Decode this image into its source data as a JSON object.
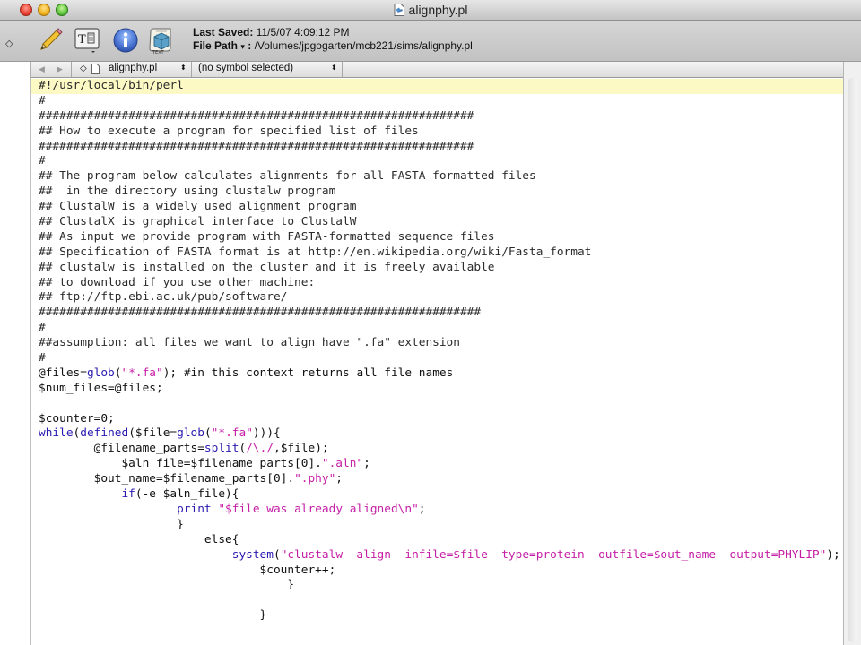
{
  "window": {
    "title": "alignphy.pl"
  },
  "toolbar": {
    "last_saved_label": "Last Saved:",
    "last_saved_value": "11/5/07 4:09:12 PM",
    "file_path_label": "File Path",
    "file_path_arrow": "▾",
    "file_path_sep": ":",
    "file_path_value": "/Volumes/jpgogarten/mcb221/sims/alignphy.pl",
    "icons": [
      "pencil-icon",
      "text-options-icon",
      "info-icon",
      "script-icon"
    ]
  },
  "navbar": {
    "back": "◀",
    "forward": "▶",
    "file_name": "alignphy.pl",
    "file_updown": "⬍",
    "symbol": "(no symbol selected)",
    "symbol_updown": "⬍"
  },
  "colors": {
    "comment": "#2b2b2b",
    "keyword": "#2a1ab0",
    "string": "#c51ea6",
    "highlight_line": "#fdf9c4"
  },
  "code": {
    "lines": [
      [
        {
          "t": "#!/usr/local/bin/perl",
          "c": "cm"
        }
      ],
      [
        {
          "t": "#",
          "c": "cm"
        }
      ],
      [
        {
          "t": "###############################################################",
          "c": "cm"
        }
      ],
      [
        {
          "t": "## How to execute a program for specified list of files",
          "c": "cm"
        }
      ],
      [
        {
          "t": "###############################################################",
          "c": "cm"
        }
      ],
      [
        {
          "t": "#",
          "c": "cm"
        }
      ],
      [
        {
          "t": "## The program below calculates alignments for all FASTA-formatted files",
          "c": "cm"
        }
      ],
      [
        {
          "t": "##  in the directory using clustalw program",
          "c": "cm"
        }
      ],
      [
        {
          "t": "## ClustalW is a widely used alignment program",
          "c": "cm"
        }
      ],
      [
        {
          "t": "## ClustalX is graphical interface to ClustalW",
          "c": "cm"
        }
      ],
      [
        {
          "t": "## As input we provide program with FASTA-formatted sequence files",
          "c": "cm"
        }
      ],
      [
        {
          "t": "## Specification of FASTA format is at http://en.wikipedia.org/wiki/Fasta_format",
          "c": "cm"
        }
      ],
      [
        {
          "t": "## clustalw is installed on the cluster and it is freely available",
          "c": "cm"
        }
      ],
      [
        {
          "t": "## to download if you use other machine:",
          "c": "cm"
        }
      ],
      [
        {
          "t": "## ftp://ftp.ebi.ac.uk/pub/software/",
          "c": "cm"
        }
      ],
      [
        {
          "t": "################################################################",
          "c": "cm"
        }
      ],
      [
        {
          "t": "#",
          "c": "cm"
        }
      ],
      [
        {
          "t": "##assumption: all files we want to align have \".fa\" extension",
          "c": "cm"
        }
      ],
      [
        {
          "t": "#",
          "c": "cm"
        }
      ],
      [
        {
          "t": "@files=",
          "c": "pl"
        },
        {
          "t": "glob",
          "c": "kw"
        },
        {
          "t": "(",
          "c": "pl"
        },
        {
          "t": "\"*.fa\"",
          "c": "st"
        },
        {
          "t": "); #in this context returns all file names",
          "c": "pl"
        }
      ],
      [
        {
          "t": "$num_files=@files;",
          "c": "pl"
        }
      ],
      [
        {
          "t": "",
          "c": "pl"
        }
      ],
      [
        {
          "t": "$counter=0;",
          "c": "pl"
        }
      ],
      [
        {
          "t": "while",
          "c": "kw"
        },
        {
          "t": "(",
          "c": "pl"
        },
        {
          "t": "defined",
          "c": "kw"
        },
        {
          "t": "($file=",
          "c": "pl"
        },
        {
          "t": "glob",
          "c": "kw"
        },
        {
          "t": "(",
          "c": "pl"
        },
        {
          "t": "\"*.fa\"",
          "c": "st"
        },
        {
          "t": "))){",
          "c": "pl"
        }
      ],
      [
        {
          "t": "        @filename_parts=",
          "c": "pl"
        },
        {
          "t": "split",
          "c": "kw"
        },
        {
          "t": "(",
          "c": "pl"
        },
        {
          "t": "/\\./",
          "c": "st"
        },
        {
          "t": ",$file);",
          "c": "pl"
        }
      ],
      [
        {
          "t": "            $aln_file=$filename_parts[0].",
          "c": "pl"
        },
        {
          "t": "\".aln\"",
          "c": "st"
        },
        {
          "t": ";",
          "c": "pl"
        }
      ],
      [
        {
          "t": "        $out_name=$filename_parts[0].",
          "c": "pl"
        },
        {
          "t": "\".phy\"",
          "c": "st"
        },
        {
          "t": ";",
          "c": "pl"
        }
      ],
      [
        {
          "t": "            ",
          "c": "pl"
        },
        {
          "t": "if",
          "c": "kw"
        },
        {
          "t": "(-e $aln_file){",
          "c": "pl"
        }
      ],
      [
        {
          "t": "                    ",
          "c": "pl"
        },
        {
          "t": "print",
          "c": "kw"
        },
        {
          "t": " ",
          "c": "pl"
        },
        {
          "t": "\"$file was already aligned\\n\"",
          "c": "st"
        },
        {
          "t": ";",
          "c": "pl"
        }
      ],
      [
        {
          "t": "                    }",
          "c": "pl"
        }
      ],
      [
        {
          "t": "                        else{",
          "c": "pl"
        }
      ],
      [
        {
          "t": "                            ",
          "c": "pl"
        },
        {
          "t": "system",
          "c": "kw"
        },
        {
          "t": "(",
          "c": "pl"
        },
        {
          "t": "\"clustalw -align -infile=$file -type=protein -outfile=$out_name -output=PHYLIP\"",
          "c": "st"
        },
        {
          "t": ");",
          "c": "pl"
        }
      ],
      [
        {
          "t": "                                $counter++;",
          "c": "pl"
        }
      ],
      [
        {
          "t": "                                    }",
          "c": "pl"
        }
      ],
      [
        {
          "t": "",
          "c": "pl"
        }
      ],
      [
        {
          "t": "                                }",
          "c": "pl"
        }
      ]
    ]
  }
}
